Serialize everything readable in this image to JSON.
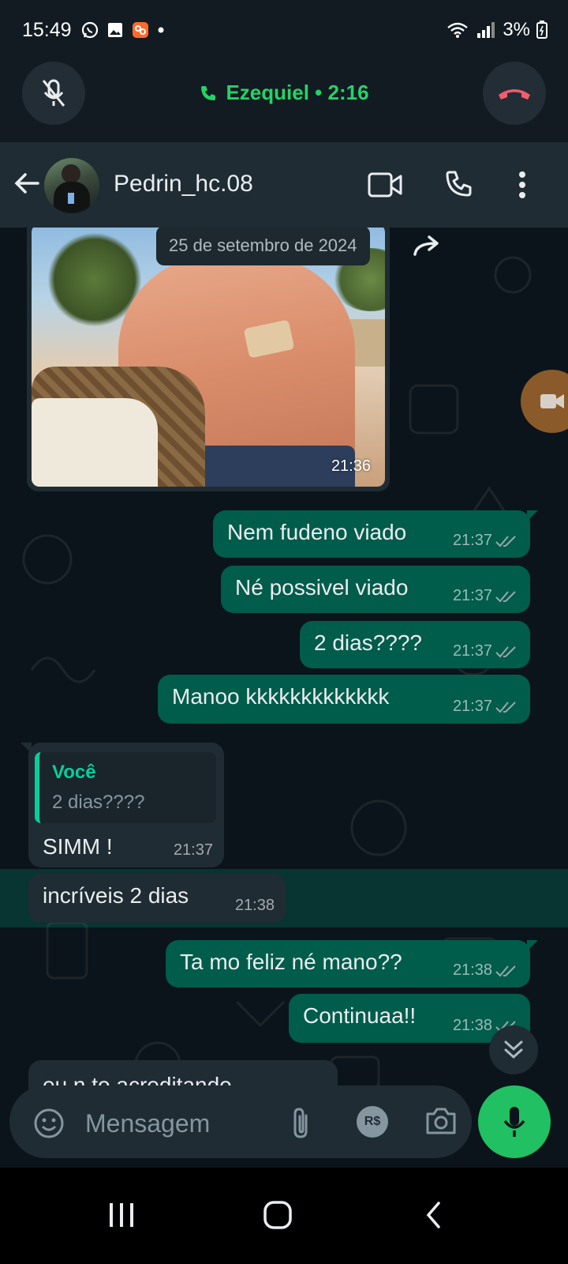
{
  "status_bar": {
    "time": "15:49",
    "battery": "3%"
  },
  "call": {
    "caller": "Ezequiel • 2:16"
  },
  "header": {
    "contact_name": "Pedrin_hc.08"
  },
  "chat": {
    "date_chip": "25 de setembro de 2024",
    "photo_time": "21:36",
    "messages": [
      {
        "text": "Nem fudeno viado",
        "time": "21:37"
      },
      {
        "text": "Né possivel viado",
        "time": "21:37"
      },
      {
        "text": "2 dias????",
        "time": "21:37"
      },
      {
        "text": "Manoo kkkkkkkkkkkkk",
        "time": "21:37"
      },
      {
        "text": "SIMM !",
        "time": "21:37",
        "quote_author": "Você",
        "quote_text": "2 dias????"
      },
      {
        "text": "incríveis 2 dias",
        "time": "21:38"
      },
      {
        "text": "Ta mo feliz né mano??",
        "time": "21:38"
      },
      {
        "text": "Continuaa!!",
        "time": "21:38"
      },
      {
        "text": "eu n to acreditando"
      }
    ]
  },
  "composer": {
    "placeholder": "Mensagem",
    "pay_label": "R$"
  },
  "colors": {
    "accent_green": "#25d366",
    "outgoing_bubble": "#005c4b",
    "incoming_bubble": "#202c33",
    "end_call": "#f15c6d"
  }
}
